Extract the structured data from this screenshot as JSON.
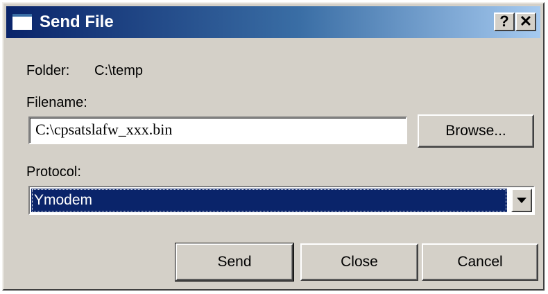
{
  "window": {
    "title": "Send File",
    "help_label": "?",
    "close_label": "✕"
  },
  "folder": {
    "label": "Folder:",
    "value": "C:\\temp"
  },
  "filename": {
    "label": "Filename:",
    "value": "C:\\cpsatslafw_xxx.bin",
    "browse_label": "Browse..."
  },
  "protocol": {
    "label": "Protocol:",
    "selected": "Ymodem"
  },
  "buttons": {
    "send_label": "Send",
    "close_label": "Close",
    "cancel_label": "Cancel"
  },
  "colors": {
    "titlebar_start": "#0a246a",
    "titlebar_end": "#a6caf0",
    "dialog_face": "#d4d0c8",
    "selection": "#0a246a"
  }
}
